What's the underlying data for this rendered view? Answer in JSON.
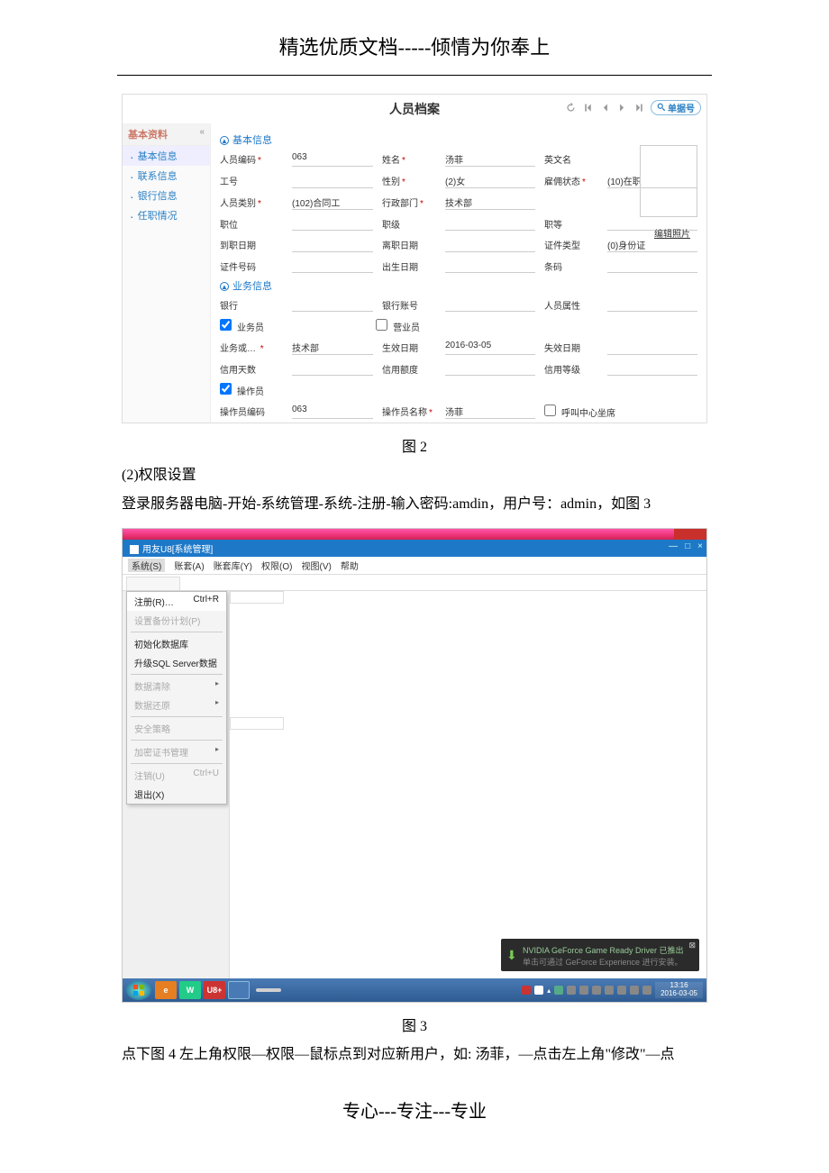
{
  "doc": {
    "header": "精选优质文档-----倾情为你奉上",
    "footer": "专心---专注---专业",
    "fig2": "图 2",
    "fig3": "图 3",
    "para_title": "(2)权限设置",
    "para1": "登录服务器电脑-开始-系统管理-系统-注册-输入密码:amdin，用户号：admin，如图 3",
    "para2": "点下图 4 左上角权限—权限—鼠标点到对应新用户，如: 汤菲，—点击左上角\"修改\"—点"
  },
  "app1": {
    "title": "人员档案",
    "tools": {
      "search_label": "单据号"
    },
    "sidebar": {
      "head": "基本资料",
      "items": [
        {
          "label": "基本信息",
          "active": true
        },
        {
          "label": "联系信息"
        },
        {
          "label": "银行信息"
        },
        {
          "label": "任职情况"
        }
      ]
    },
    "sections": {
      "basic": "基本信息",
      "biz": "业务信息"
    },
    "photo_edit": "编辑照片",
    "fields": {
      "code_lbl": "人员编码",
      "code_val": "063",
      "name_lbl": "姓名",
      "name_val": "汤菲",
      "enname_lbl": "英文名",
      "jobno_lbl": "工号",
      "sex_lbl": "性别",
      "sex_val": "(2)女",
      "emp_lbl": "雇佣状态",
      "emp_val": "(10)在职",
      "cat_lbl": "人员类别",
      "cat_val": "(102)合同工",
      "dept_lbl": "行政部门",
      "dept_val": "技术部",
      "pos_lbl": "职位",
      "rank_lbl": "职级",
      "grade_lbl": "职等",
      "hire_lbl": "到职日期",
      "leave_lbl": "离职日期",
      "idtype_lbl": "证件类型",
      "idtype_val": "(0)身份证",
      "idno_lbl": "证件号码",
      "birth_lbl": "出生日期",
      "barcode_lbl": "条码",
      "bank_lbl": "银行",
      "acct_lbl": "银行账号",
      "attr_lbl": "人员属性",
      "sales_chk": "业务员",
      "clerk_chk": "营业员",
      "bizdept_lbl": "业务或… ",
      "bizdept_val": "技术部",
      "effdate_lbl": "生效日期",
      "effdate_val": "2016-03-05",
      "expdate_lbl": "失效日期",
      "credday_lbl": "信用天数",
      "credamt_lbl": "信用额度",
      "credlvl_lbl": "信用等级",
      "oper_chk": "操作员",
      "opercode_lbl": "操作员编码",
      "opercode_val": "063",
      "opername_lbl": "操作员名称",
      "opername_val": "汤菲",
      "callseat_chk": "呼叫中心坐席"
    }
  },
  "app2": {
    "title": "用友U8[系统管理]",
    "menu": [
      "系统(S)",
      "账套(A)",
      "账套库(Y)",
      "权限(O)",
      "视图(V)",
      "帮助"
    ],
    "dropdown": [
      {
        "label": "注册(R)…",
        "shortcut": "Ctrl+R",
        "hl": true
      },
      {
        "label": "设置备份计划(P)",
        "dis": true
      },
      {
        "sep": true
      },
      {
        "label": "初始化数据库"
      },
      {
        "label": "升级SQL Server数据"
      },
      {
        "sep": true
      },
      {
        "label": "数据清除",
        "dis": true,
        "sub": true
      },
      {
        "label": "数据还原",
        "dis": true,
        "sub": true
      },
      {
        "sep": true
      },
      {
        "label": "安全策略",
        "dis": true
      },
      {
        "sep": true
      },
      {
        "label": "加密证书管理",
        "dis": true,
        "sub": true
      },
      {
        "sep": true
      },
      {
        "label": "注销(U)",
        "shortcut": "Ctrl+U",
        "dis": true
      },
      {
        "label": "退出(X)"
      }
    ],
    "notif": {
      "line1": "NVIDIA GeForce Game Ready Driver 已推出",
      "line2": "单击可通过 GeForce Experience 进行安装。"
    },
    "taskbar": {
      "icons": [
        "e",
        "W",
        "U8+",
        ""
      ],
      "active": "",
      "time": "13:16",
      "date": "2016-03-05"
    }
  }
}
